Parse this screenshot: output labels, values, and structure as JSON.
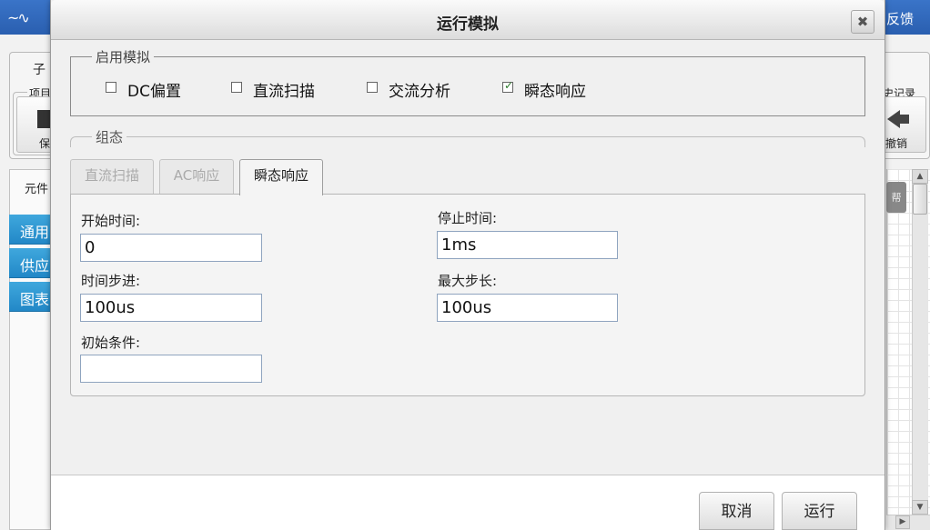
{
  "app": {
    "logo_glyph": "~∿",
    "feedback_label": "反馈",
    "toolbar_tab_label": "子",
    "project_group_label": "项目",
    "save_label": "保",
    "history_group_label": "史记录",
    "undo_label": "撤销",
    "sidebar_title": "元件",
    "sidebar_items": [
      "通用",
      "供应",
      "图表"
    ],
    "canvas_button_label": "帮"
  },
  "dialog": {
    "title": "运行模拟",
    "close_glyph": "✖",
    "enable_group": {
      "legend": "启用模拟",
      "options": [
        {
          "label": "DC偏置",
          "checked": false
        },
        {
          "label": "直流扫描",
          "checked": false
        },
        {
          "label": "交流分析",
          "checked": false
        },
        {
          "label": "瞬态响应",
          "checked": true
        }
      ]
    },
    "config_group": {
      "legend": "组态"
    },
    "tabs": [
      {
        "label": "直流扫描",
        "active": false
      },
      {
        "label": "AC响应",
        "active": false
      },
      {
        "label": "瞬态响应",
        "active": true
      }
    ],
    "transient": {
      "start_time": {
        "label": "开始时间:",
        "value": "0"
      },
      "stop_time": {
        "label": "停止时间:",
        "value": "1ms"
      },
      "time_step": {
        "label": "时间步进:",
        "value": "100us"
      },
      "max_step": {
        "label": "最大步长:",
        "value": "100us"
      },
      "initial_conditions": {
        "label": "初始条件:",
        "value": ""
      }
    },
    "buttons": {
      "cancel": "取消",
      "run": "运行"
    }
  },
  "colors": {
    "topbar": "#2a5fb0",
    "sidebar_item": "#2288c7",
    "checkbox_mark": "#2b7a2b",
    "input_border": "#8fa4bf"
  }
}
